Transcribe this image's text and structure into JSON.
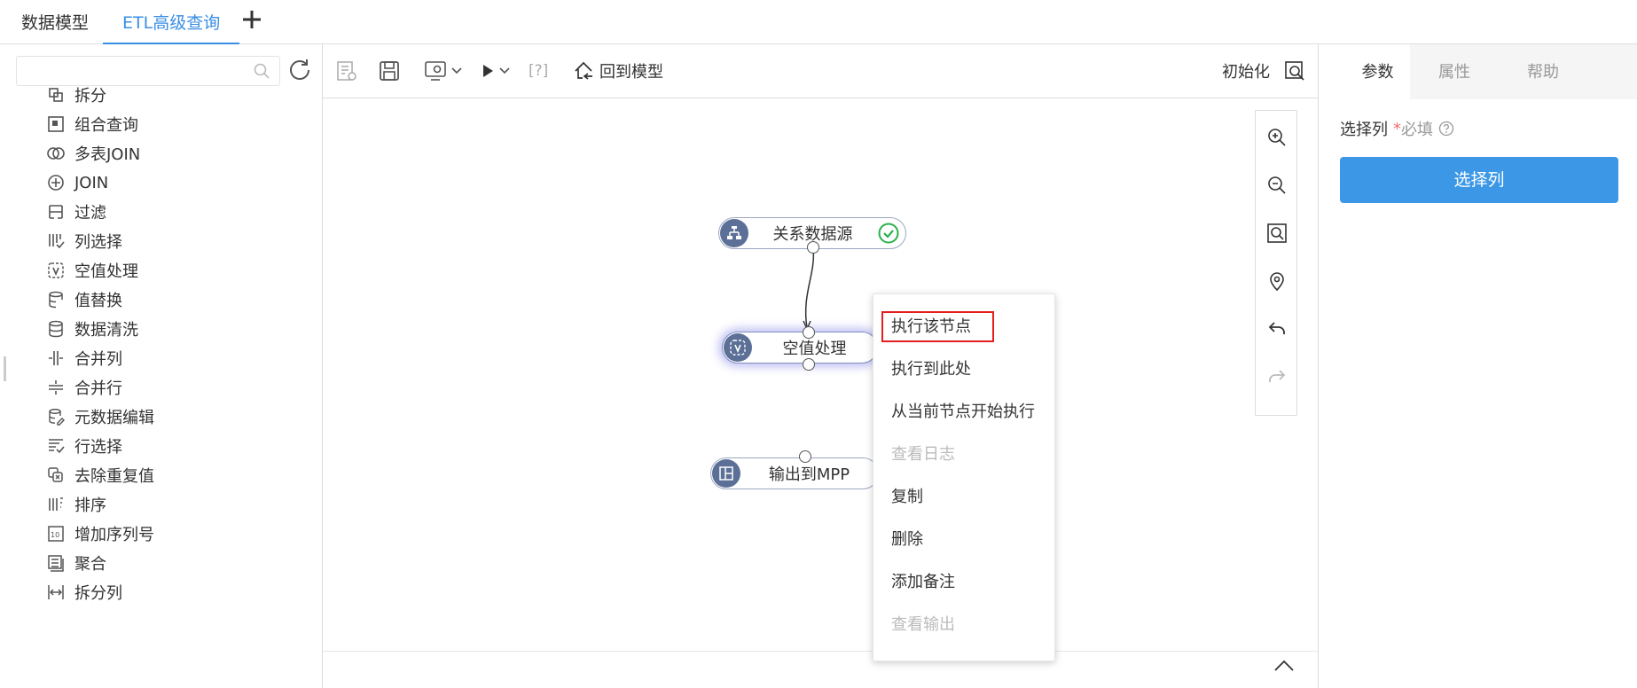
{
  "top_tabs": [
    {
      "label": "数据模型"
    },
    {
      "label": "ETL高级查询"
    }
  ],
  "left_panel": {
    "search": {
      "placeholder": "",
      "value": ""
    },
    "items": [
      {
        "label": "拆分",
        "icon": "split-icon"
      },
      {
        "label": "组合查询",
        "icon": "combine-query-icon"
      },
      {
        "label": "多表JOIN",
        "icon": "multi-join-icon"
      },
      {
        "label": "JOIN",
        "icon": "join-icon"
      },
      {
        "label": "过滤",
        "icon": "filter-icon"
      },
      {
        "label": "列选择",
        "icon": "column-select-icon"
      },
      {
        "label": "空值处理",
        "icon": "null-handle-icon"
      },
      {
        "label": "值替换",
        "icon": "value-replace-icon"
      },
      {
        "label": "数据清洗",
        "icon": "data-clean-icon"
      },
      {
        "label": "合并列",
        "icon": "merge-column-icon"
      },
      {
        "label": "合并行",
        "icon": "merge-row-icon"
      },
      {
        "label": "元数据编辑",
        "icon": "metadata-edit-icon"
      },
      {
        "label": "行选择",
        "icon": "row-select-icon"
      },
      {
        "label": "去除重复值",
        "icon": "dedupe-icon"
      },
      {
        "label": "排序",
        "icon": "sort-icon"
      },
      {
        "label": "增加序列号",
        "icon": "add-sequence-icon"
      },
      {
        "label": "聚合",
        "icon": "aggregate-icon"
      },
      {
        "label": "拆分列",
        "icon": "split-column-icon"
      }
    ]
  },
  "toolbar": {
    "back_to_model": "回到模型",
    "bracket_q": "[?]",
    "init": "初始化"
  },
  "nodes": [
    {
      "label": "关系数据源",
      "status": "success"
    },
    {
      "label": "空值处理"
    },
    {
      "label": "输出到MPP"
    }
  ],
  "context_menu": {
    "items": [
      {
        "label": "执行该节点",
        "disabled": false
      },
      {
        "label": "执行到此处",
        "disabled": false
      },
      {
        "label": "从当前节点开始执行",
        "disabled": false
      },
      {
        "label": "查看日志",
        "disabled": true
      },
      {
        "label": "复制",
        "disabled": false
      },
      {
        "label": "删除",
        "disabled": false
      },
      {
        "label": "添加备注",
        "disabled": false
      },
      {
        "label": "查看输出",
        "disabled": true
      }
    ]
  },
  "right_panel": {
    "tabs": [
      {
        "label": "参数"
      },
      {
        "label": "属性"
      },
      {
        "label": "帮助"
      }
    ],
    "field_label": "选择列",
    "required_mark": "*",
    "required_text": "必填",
    "select_button": "选择列"
  },
  "colors": {
    "accent": "#3a8ee6",
    "button": "#3c98e6",
    "node_icon": "#5c6f96",
    "success": "#2bb24c",
    "highlight_border": "#e41e1e"
  }
}
